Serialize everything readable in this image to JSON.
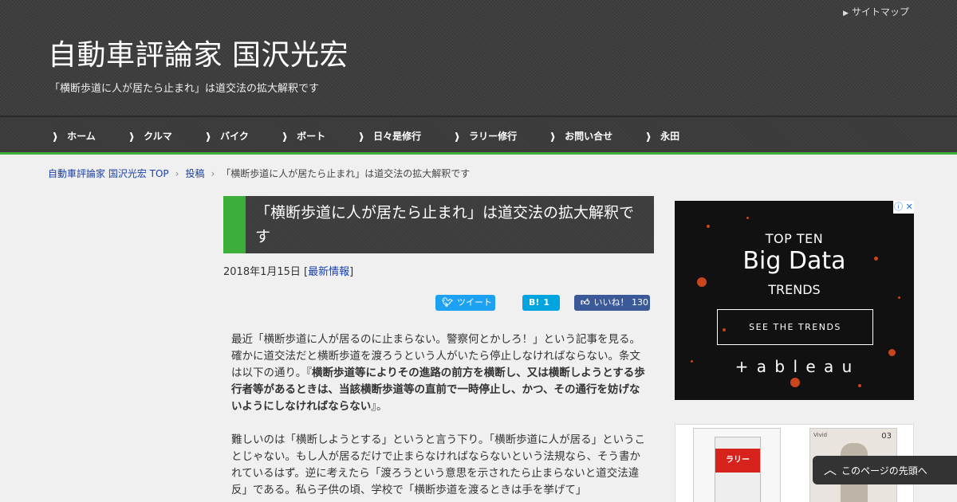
{
  "header": {
    "sitemap_link": "サイトマップ",
    "site_title": "自動車評論家 国沢光宏",
    "site_description": "「横断歩道に人が居たら止まれ」は道交法の拡大解釈です"
  },
  "nav": {
    "items": [
      "ホーム",
      "クルマ",
      "バイク",
      "ボート",
      "日々是修行",
      "ラリー修行",
      "お問い合せ",
      "永田"
    ]
  },
  "breadcrumb": {
    "home": "自動車評論家 国沢光宏 TOP",
    "posts": "投稿",
    "current": "「横断歩道に人が居たら止まれ」は道交法の拡大解釈です"
  },
  "article": {
    "title": "「横断歩道に人が居たら止まれ」は道交法の拡大解釈です",
    "date": "2018年1月15日",
    "category": "最新情報",
    "share": {
      "tweet": "ツイート",
      "hatena_icon": "B!",
      "hatena_count": "1",
      "like": "いいね！",
      "like_count": "130"
    },
    "p1_a": "最近「横断歩道に人が居るのに止まらない。警察何とかしろ！」という記事を見る。確かに道交法だと横断歩道を渡ろうという人がいたら停止しなければならない。条文は以下の通り。『",
    "p1_bold": "横断歩道等によりその進路の前方を横断し、又は横断しようとする歩行者等があるときは、当該横断歩道等の直前で一時停止し、かつ、その通行を妨げないようにしなければならない",
    "p1_b": "』。",
    "p2": "難しいのは「横断しようとする」というと言う下り。「横断歩道に人が居る」ということじゃない。もし人が居るだけで止まらなければならないという法規なら、そう書かれているはず。逆に考えたら「渡ろうという意思を示されたら止まらないと道交法違反」である。私ら子供の頃、学校で「横断歩道を渡るときは手を挙げて」"
  },
  "ad": {
    "top": "TOP TEN",
    "big": "Big Data",
    "trends": "TRENDS",
    "button": "SEE THE TRENDS",
    "logo": "+ a b l e a u",
    "close": "ⓘ ✕"
  },
  "related": {
    "thumb1_label": "ラリー",
    "thumb2_num": "03",
    "thumb2_brand": "Vivid"
  },
  "totop": {
    "label": "このページの先頭へ"
  },
  "colors": {
    "accent_green": "#3cae3a",
    "link_blue": "#1a3fa8",
    "twitter": "#1da1f2",
    "hatena": "#00a4de",
    "facebook": "#3b5998"
  }
}
